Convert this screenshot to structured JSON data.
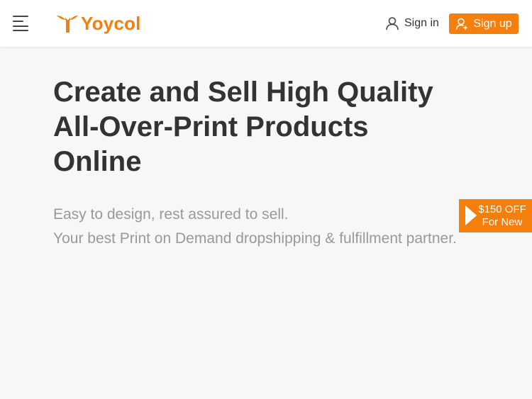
{
  "header": {
    "logo_text": "Yoycol",
    "signin_label": "Sign in",
    "signup_label": "Sign up"
  },
  "hero": {
    "title_lines": [
      "Create and Sell High Quality",
      "All-Over-Print Products",
      "Online"
    ],
    "subtitle_lines": [
      "Easy to design, rest assured to sell.",
      "Your best Print on Demand dropshipping & fulfillment partner."
    ]
  },
  "promo": {
    "line1": "$150 OFF",
    "line2": "For New"
  },
  "icons": {
    "menu": "menu-icon",
    "logo_mark": "yoycol-bird-icon",
    "signin": "user-icon",
    "signup": "user-plus-icon",
    "promo": "play-arrow-icon"
  },
  "colors": {
    "brand": "#f57f0d",
    "title": "#333333",
    "subtitle": "#999999",
    "background": "#f7f7f7",
    "header_bg": "#ffffff"
  }
}
